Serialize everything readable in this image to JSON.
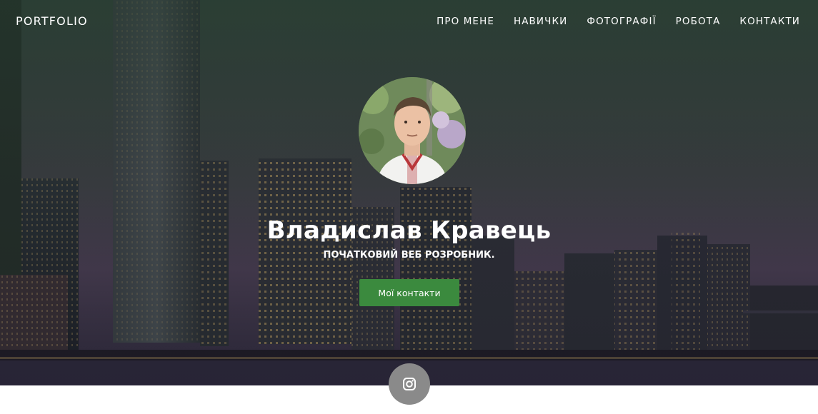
{
  "brand": "PORTFOLIO",
  "nav": {
    "items": [
      {
        "label": "ПРО МЕНЕ"
      },
      {
        "label": "НАВИЧКИ"
      },
      {
        "label": "ФОТОГРАФІЇ"
      },
      {
        "label": "РОБОТА"
      },
      {
        "label": "КОНТАКТИ"
      }
    ]
  },
  "hero": {
    "name": "Владислав Кравець",
    "subtitle": "ПОЧАТКОВИЙ ВЕБ РОЗРОБНИК.",
    "cta_label": "Мої контакти"
  },
  "social": {
    "icon": "instagram-icon"
  },
  "colors": {
    "cta": "#3b8a3e",
    "social_bg": "#8a8a8a",
    "nav_text": "#ffffff"
  }
}
